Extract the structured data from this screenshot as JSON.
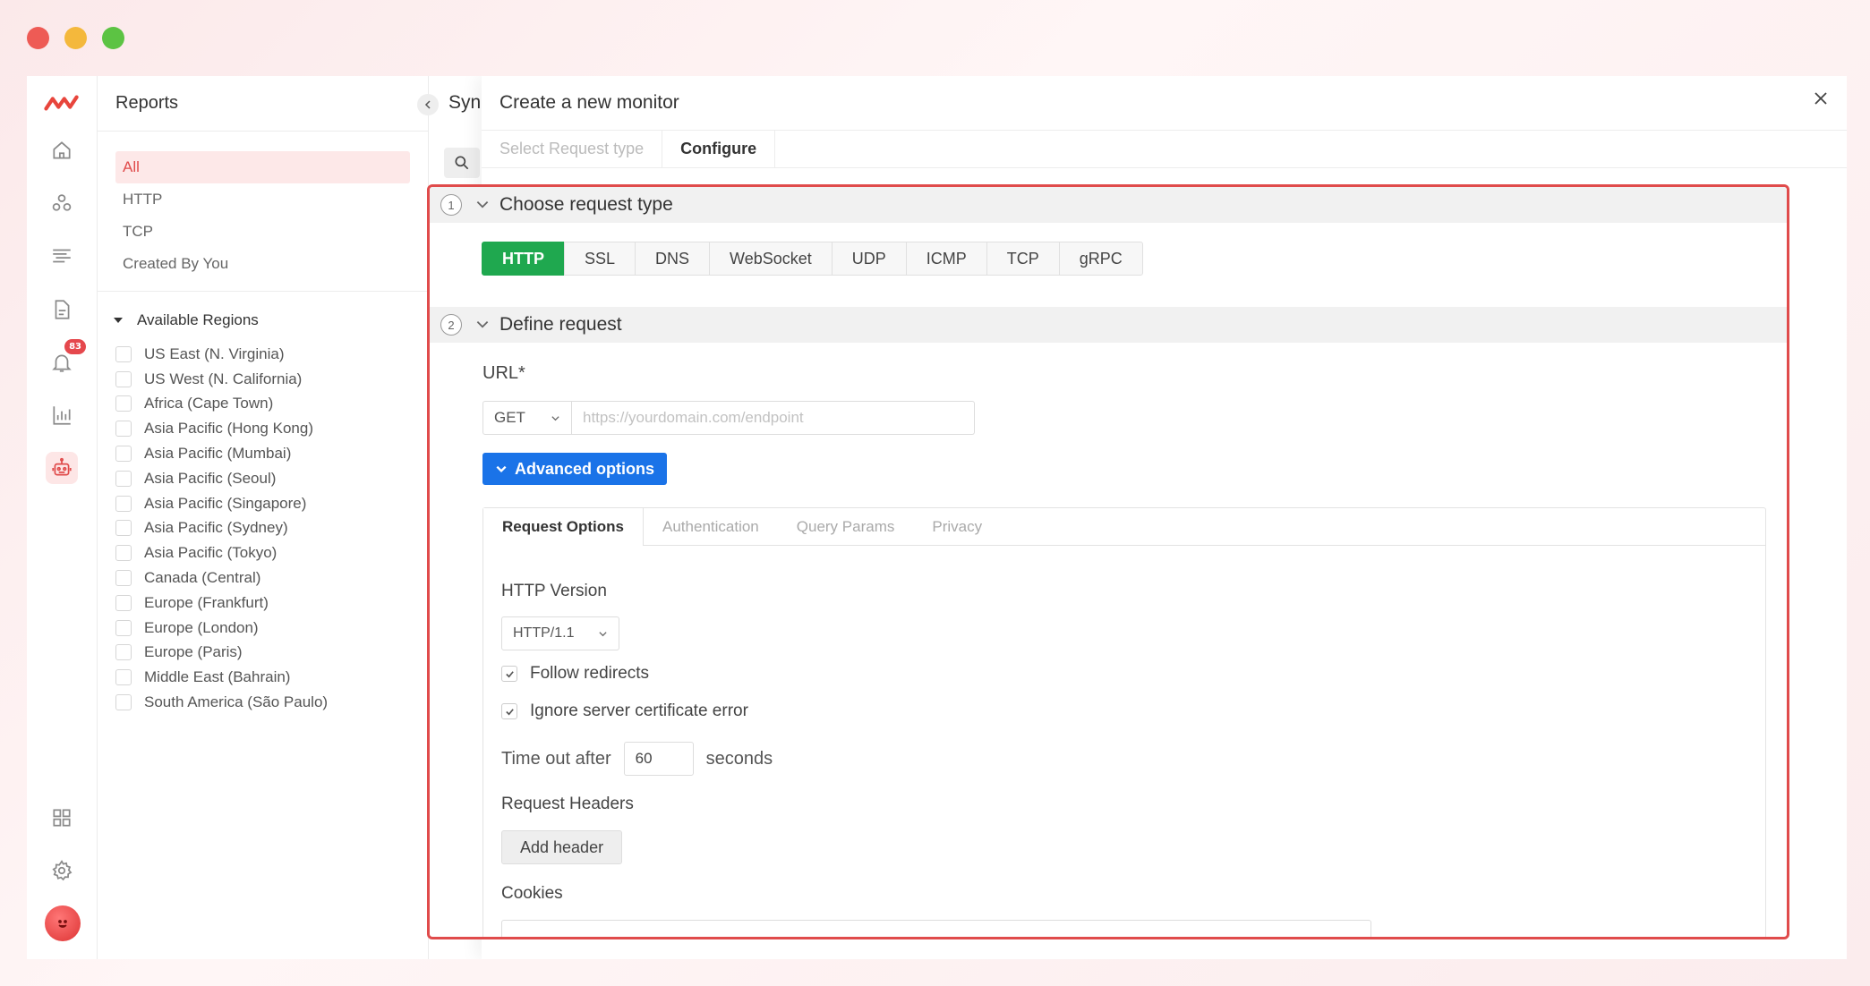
{
  "window": {
    "controls": [
      "close",
      "minimize",
      "zoom"
    ]
  },
  "rail": {
    "logo": "brand-logo",
    "items": [
      "home-icon",
      "integrations-icon",
      "logs-icon",
      "report-icon",
      "bell-icon",
      "chart-icon",
      "robot-icon"
    ],
    "notification_count": "83",
    "bottom_items": [
      "grid-icon",
      "gear-icon"
    ],
    "brand_color": "#e04b4b"
  },
  "reports": {
    "title": "Reports",
    "filters": [
      "All",
      "HTTP",
      "TCP",
      "Created By You"
    ],
    "active_filter": "All",
    "regions_title": "Available Regions",
    "regions": [
      "US East (N. Virginia)",
      "US West (N. California)",
      "Africa (Cape Town)",
      "Asia Pacific (Hong Kong)",
      "Asia Pacific (Mumbai)",
      "Asia Pacific (Seoul)",
      "Asia Pacific (Singapore)",
      "Asia Pacific (Sydney)",
      "Asia Pacific (Tokyo)",
      "Canada (Central)",
      "Europe (Frankfurt)",
      "Europe (London)",
      "Europe (Paris)",
      "Middle East (Bahrain)",
      "South America (São Paulo)"
    ]
  },
  "background": {
    "title_partial": "Syn"
  },
  "drawer": {
    "title": "Create a new monitor",
    "tabs": [
      "Select Request type",
      "Configure"
    ],
    "active_tab": "Configure"
  },
  "step1": {
    "number": "1",
    "title": "Choose request type",
    "types": [
      "HTTP",
      "SSL",
      "DNS",
      "WebSocket",
      "UDP",
      "ICMP",
      "TCP",
      "gRPC"
    ],
    "active_type": "HTTP",
    "active_color": "#1fa84f"
  },
  "step2": {
    "number": "2",
    "title": "Define request",
    "url_label": "URL*",
    "method": "GET",
    "url_value": "",
    "url_placeholder": "https://yourdomain.com/endpoint",
    "advanced_label": "Advanced options",
    "advanced_color": "#1a73e8"
  },
  "options": {
    "tabs": [
      "Request Options",
      "Authentication",
      "Query Params",
      "Privacy"
    ],
    "active_tab": "Request Options",
    "http_version_label": "HTTP Version",
    "http_version": "HTTP/1.1",
    "follow_redirects_label": "Follow redirects",
    "follow_redirects": true,
    "ignore_cert_label": "Ignore server certificate error",
    "ignore_cert": true,
    "timeout_prefix": "Time out after",
    "timeout_value": "60",
    "timeout_suffix": "seconds",
    "headers_label": "Request Headers",
    "add_header_label": "Add header",
    "cookies_label": "Cookies"
  },
  "highlight_color": "#e04b4b"
}
